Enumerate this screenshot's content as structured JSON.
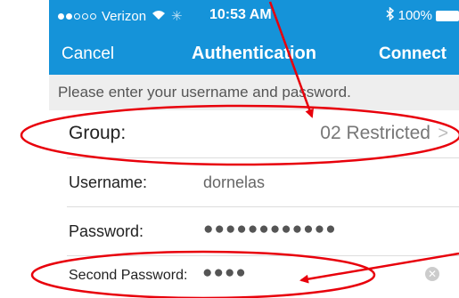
{
  "status_bar": {
    "carrier": "Verizon",
    "time": "10:53 AM",
    "battery": "100%"
  },
  "nav": {
    "cancel_label": "Cancel",
    "title": "Authentication",
    "connect_label": "Connect"
  },
  "prompt": "Please enter your username and password.",
  "form": {
    "group_label": "Group:",
    "group_value": "02 Restricted",
    "username_label": "Username:",
    "username_value": "dornelas",
    "password_label": "Password:",
    "password_value": "●●●●●●●●●●●●",
    "second_password_label": "Second Password:",
    "second_password_value": "●●●●"
  },
  "colors": {
    "header": "#1593d9",
    "annotation": "#e8000b"
  }
}
